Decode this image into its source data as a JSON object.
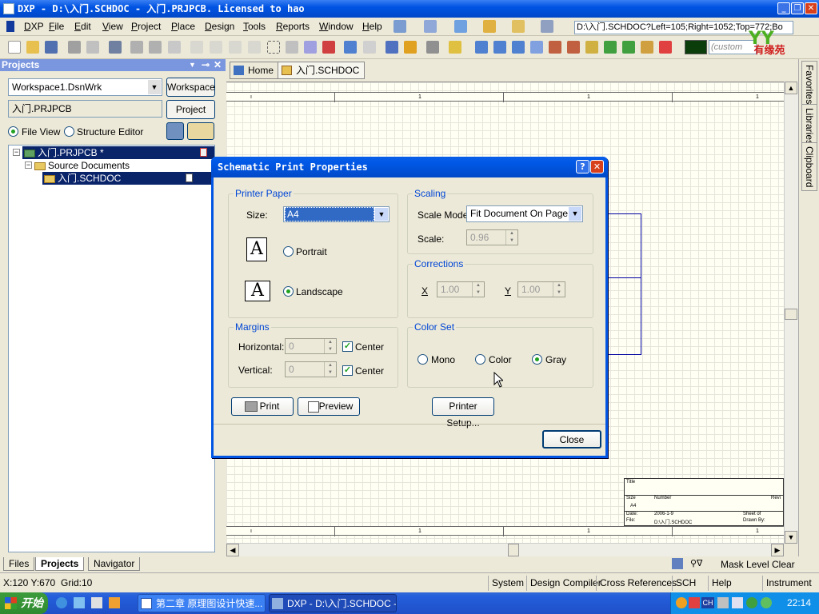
{
  "window": {
    "title": "DXP - D:\\入门.SCHDOC - 入门.PRJPCB. Licensed to hao"
  },
  "menubar": {
    "items": [
      "DXP",
      "File",
      "Edit",
      "View",
      "Project",
      "Place",
      "Design",
      "Tools",
      "Reports",
      "Window",
      "Help"
    ]
  },
  "toolbar": {
    "path": "D:\\入门.SCHDOC?Left=105;Right=1052;Top=772;Bo",
    "custom": "(custom",
    "logo": "有缘苑"
  },
  "projects": {
    "header": "Projects",
    "workspace_value": "Workspace1.DsnWrk",
    "workspace_button": "Workspace",
    "project_value": "入门.PRJPCB",
    "project_button": "Project",
    "view_file": "File View",
    "view_structure": "Structure Editor",
    "tree": {
      "project": "入门.PRJPCB *",
      "folder": "Source Documents",
      "document": "入门.SCHDOC"
    }
  },
  "panel_tabs": [
    "Files",
    "Projects",
    "Navigator"
  ],
  "doc_tabs": {
    "home": "Home",
    "doc": "入门.SCHDOC"
  },
  "right_dock": [
    "Favorites",
    "Libraries",
    "Clipboard"
  ],
  "sheet": {
    "ruler_labels": [
      "1",
      "1",
      "1"
    ],
    "title_block": {
      "title": "Title",
      "size": "Size",
      "number": "Number",
      "rev": "Revi",
      "a4": "A4",
      "date": "Date:",
      "date_val": "2006-1-9",
      "file": "File:",
      "file_val": "D:\\入门.SCHDOC",
      "sheet": "Sheet   of",
      "drawn": "Drawn By:"
    }
  },
  "sheet_bar": {
    "mask": "Mask Level",
    "clear": "Clear"
  },
  "status": {
    "coords": "X:120 Y:670",
    "grid": "Grid:10",
    "tabs": [
      "System",
      "Design Compiler",
      "Cross References",
      "SCH",
      "Help",
      "Instrument Racks"
    ]
  },
  "taskbar": {
    "start": "开始",
    "tasks": [
      "第二章 原理图设计快速...",
      "DXP - D:\\入门.SCHDOC - ..."
    ],
    "clock": "22:14"
  },
  "dialog": {
    "title": "Schematic Print Properties",
    "printer_paper": {
      "legend": "Printer Paper",
      "size_label": "Size:",
      "size_value": "A4",
      "portrait": "Portrait",
      "landscape": "Landscape",
      "orientation": "Landscape"
    },
    "scaling": {
      "legend": "Scaling",
      "mode_label": "Scale Mode",
      "mode_value": "Fit Document On Page",
      "scale_label": "Scale:",
      "scale_value": "0.96"
    },
    "corrections": {
      "legend": "Corrections",
      "x_label": "X",
      "x_value": "1.00",
      "y_label": "Y",
      "y_value": "1.00"
    },
    "margins": {
      "legend": "Margins",
      "h_label": "Horizontal:",
      "h_value": "0",
      "v_label": "Vertical:",
      "v_value": "0",
      "center": "Center",
      "h_center": true,
      "v_center": true
    },
    "color_set": {
      "legend": "Color Set",
      "mono": "Mono",
      "color": "Color",
      "gray": "Gray",
      "selected": "Gray"
    },
    "buttons": {
      "print": "Print",
      "preview": "Preview",
      "printer_setup": "Printer Setup...",
      "close": "Close"
    }
  }
}
